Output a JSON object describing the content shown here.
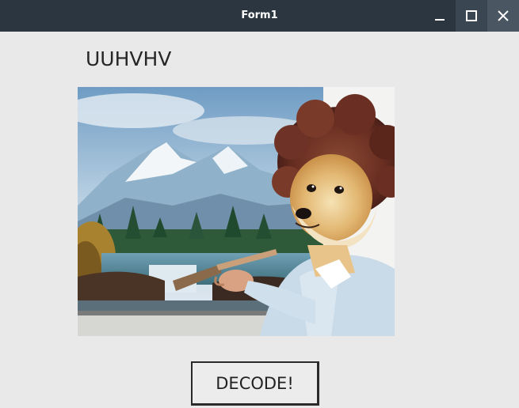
{
  "window": {
    "title": "Form1",
    "controls": {
      "minimize_icon": "minimize-icon",
      "maximize_icon": "maximize-icon",
      "close_icon": "close-icon"
    },
    "colors": {
      "titlebar": "#2b3640",
      "background": "#e9e9e9"
    }
  },
  "form": {
    "encoded_label": "UUHVHV",
    "picture": {
      "subject": "painter-dog-image"
    },
    "decode_button_label": "DECODE!"
  }
}
